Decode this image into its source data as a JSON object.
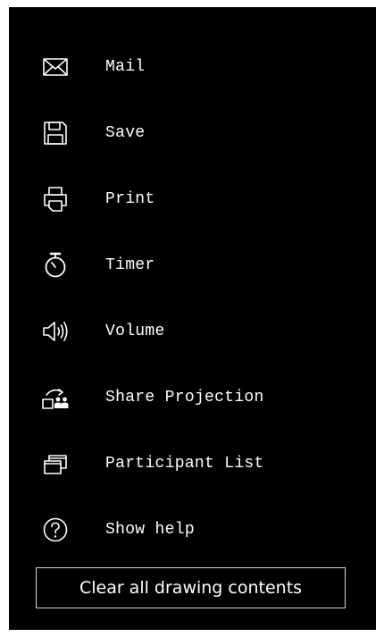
{
  "menu": {
    "items": [
      {
        "label": "Mail",
        "icon": "mail-icon"
      },
      {
        "label": "Save",
        "icon": "save-icon"
      },
      {
        "label": "Print",
        "icon": "print-icon"
      },
      {
        "label": "Timer",
        "icon": "timer-icon"
      },
      {
        "label": "Volume",
        "icon": "volume-icon"
      },
      {
        "label": "Share Projection",
        "icon": "share-projection-icon"
      },
      {
        "label": "Participant List",
        "icon": "participant-list-icon"
      },
      {
        "label": "Show help",
        "icon": "help-icon"
      }
    ]
  },
  "clear_button": {
    "label": "Clear all drawing contents"
  },
  "colors": {
    "panel_background": "#000000",
    "text": "#ffffff",
    "button_border": "#d9d9d9"
  }
}
